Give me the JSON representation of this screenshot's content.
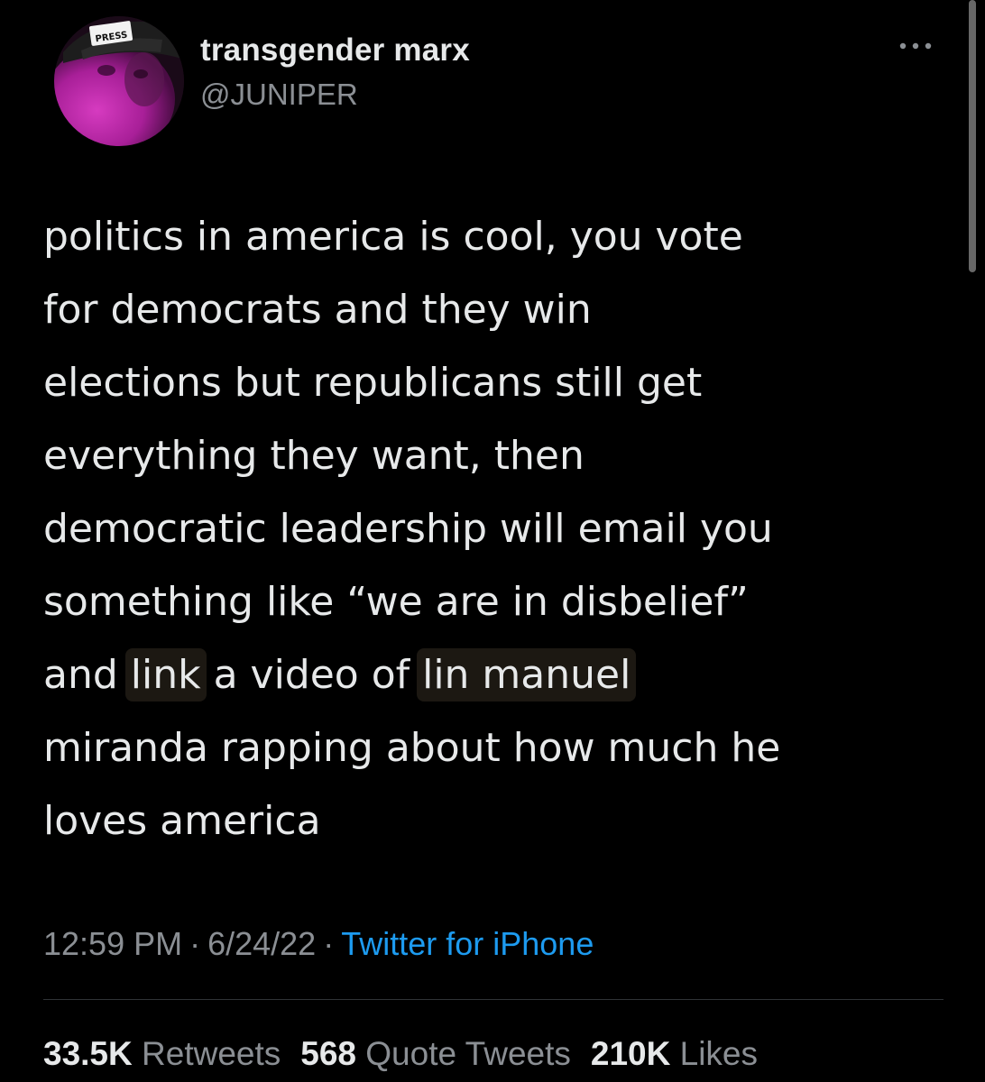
{
  "tweet": {
    "author": {
      "display_name": "transgender marx",
      "handle": "@JUNIPER",
      "avatar_icon": "avatar-press-hat-pink-face",
      "avatar_hat_text": "PRESS"
    },
    "more_icon": "more-horizontal-icon",
    "text_lines": [
      "politics in america is cool, you vote",
      "for democrats and they win",
      "elections but republicans still get",
      "everything they want, then",
      "democratic leadership will email you",
      "something like “we are in disbelief”",
      {
        "before": "and ",
        "hl1": "link",
        "mid": " a video of ",
        "hl2": "lin manuel"
      },
      "miranda rapping about how much he",
      "loves america"
    ],
    "line6": {
      "before": "and ",
      "hl1": "link",
      "mid": " a video of ",
      "hl2": "lin manuel"
    },
    "time": "12:59 PM",
    "date": "6/24/22",
    "separator": "·",
    "source": "Twitter for iPhone",
    "stats": {
      "retweets_count": "33.5K",
      "retweets_label": "Retweets",
      "quotes_count": "568",
      "quotes_label": "Quote Tweets",
      "likes_count": "210K",
      "likes_label": "Likes"
    }
  },
  "colors": {
    "background": "#000000",
    "primary_text": "#e7e9ea",
    "secondary_text": "#8b8f94",
    "link": "#1d9bf0",
    "divider": "#2f3336",
    "highlight": "#1c1812"
  }
}
